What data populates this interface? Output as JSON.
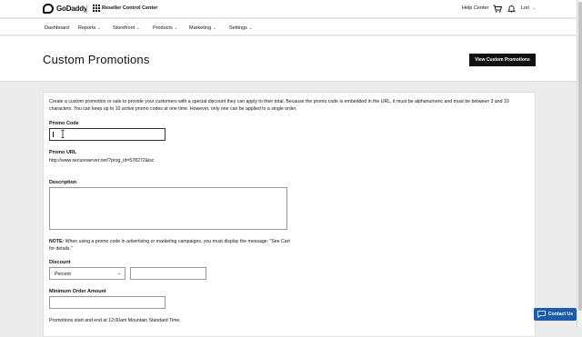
{
  "topbar": {
    "logo": "GoDaddy",
    "app_name": "Reseller Control Center",
    "help": "Help Center",
    "user": "Lori",
    "user_chevron": "⌄"
  },
  "nav": {
    "items": [
      {
        "label": "Dashboard",
        "has_menu": false
      },
      {
        "label": "Reports",
        "has_menu": true
      },
      {
        "label": "Storefront",
        "has_menu": true
      },
      {
        "label": "Products",
        "has_menu": true
      },
      {
        "label": "Marketing",
        "has_menu": true
      },
      {
        "label": "Settings",
        "has_menu": true
      }
    ],
    "chevron": "⌄"
  },
  "page": {
    "title": "Custom Promotions",
    "view_button": "View Custom Promotions"
  },
  "form": {
    "intro": "Create a custom promotion or sale to provide your customers with a special discount they can apply to their total. Because the promo code is embedded in the URL, it must be alphanumeric and must be between 3 and 10 characters. You can keep up to 10 active promo codes at one time. However, only one can be applied to a single order.",
    "promo_code_label": "Promo Code",
    "promo_code_value": "",
    "promo_url_label": "Promo URL",
    "promo_url_value": "http://www.secureserver.net/?prog_id=578272&isc",
    "description_label": "Description",
    "description_value": "",
    "note_label": "NOTE:",
    "note_text": " When using a promo code in advertising or marketing campaigns, you must display the message: \"See Cart for details.\"",
    "discount_label": "Discount",
    "discount_type": "Percent",
    "discount_value": "",
    "min_order_label": "Minimum Order Amount",
    "min_order_value": "",
    "timezone_text": "Promotions start and end at 12:00am Mountain Standard Time."
  },
  "contact": {
    "label": "Contact Us"
  },
  "icons": {
    "logo": "godaddy-logo-icon",
    "apps": "app-grid-icon",
    "cart": "cart-icon",
    "bell": "bell-icon",
    "chat": "chat-icon"
  },
  "colors": {
    "primary_button": "#111111",
    "contact_button": "#1c5cab"
  }
}
